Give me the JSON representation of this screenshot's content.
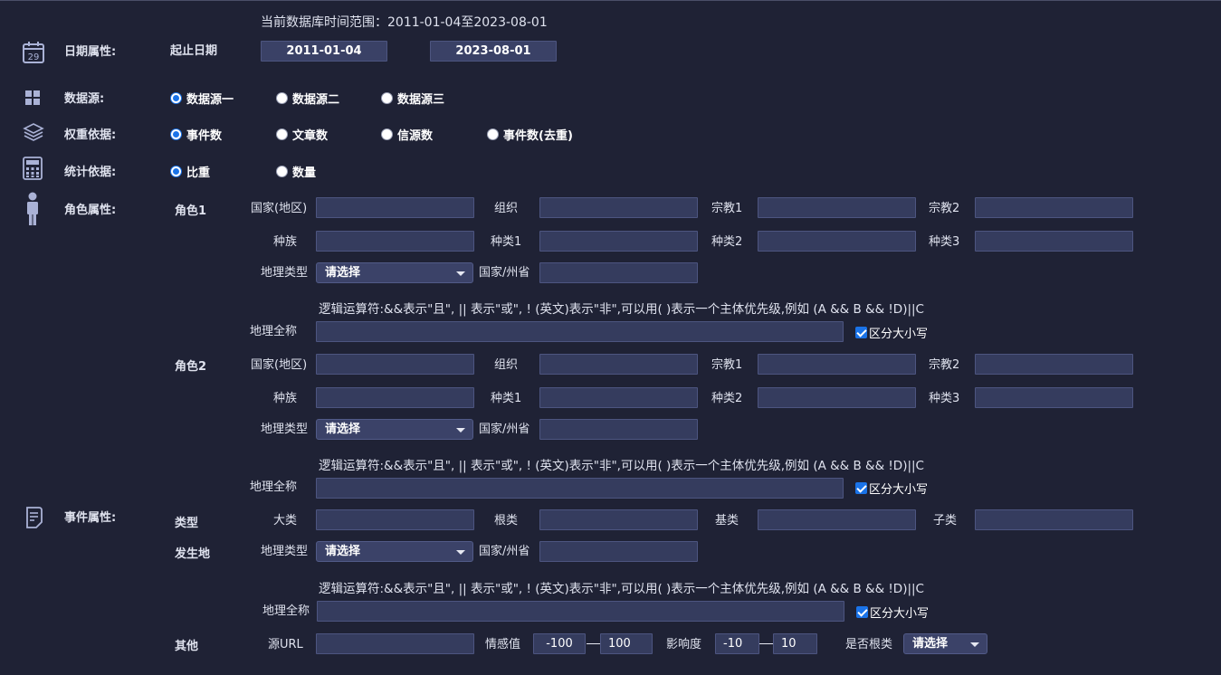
{
  "header": {
    "range_text": "当前数据库时间范围：2011-01-04至2023-08-01"
  },
  "date": {
    "label": "日期属性:",
    "sub_label": "起止日期",
    "start": "2011-01-04",
    "end": "2023-08-01"
  },
  "datasource": {
    "label": "数据源:",
    "options": [
      "数据源一",
      "数据源二",
      "数据源三"
    ],
    "selected": "数据源一"
  },
  "weight": {
    "label": "权重依据:",
    "options": [
      "事件数",
      "文章数",
      "信源数",
      "事件数(去重)"
    ],
    "selected": "事件数"
  },
  "stat": {
    "label": "统计依据:",
    "options": [
      "比重",
      "数量"
    ],
    "selected": "比重"
  },
  "role": {
    "label": "角色属性:",
    "role1": "角色1",
    "role2": "角色2",
    "fields": {
      "country": "国家(地区)",
      "org": "组织",
      "religion1": "宗教1",
      "religion2": "宗教2",
      "ethnic": "种族",
      "kind1": "种类1",
      "kind2": "种类2",
      "kind3": "种类3",
      "geo_type": "地理类型",
      "province": "国家/州省",
      "geo_full": "地理全称"
    },
    "select_placeholder": "请选择",
    "logic_hint": "逻辑运算符:&&表示\"且\", || 表示\"或\", ! (英文)表示\"非\",可以用( )表示一个主体优先级,例如 (A && B && !D)||C",
    "case_sensitive": "区分大小写"
  },
  "event": {
    "label": "事件属性:",
    "type_label": "类型",
    "place_label": "发生地",
    "other_label": "其他",
    "type_fields": {
      "big": "大类",
      "root": "根类",
      "base": "基类",
      "sub": "子类"
    },
    "url_label": "源URL",
    "sentiment_label": "情感值",
    "sentiment_min": "-100",
    "sentiment_max": "100",
    "impact_label": "影响度",
    "impact_min": "-10",
    "impact_max": "10",
    "is_root_label": "是否根类"
  }
}
